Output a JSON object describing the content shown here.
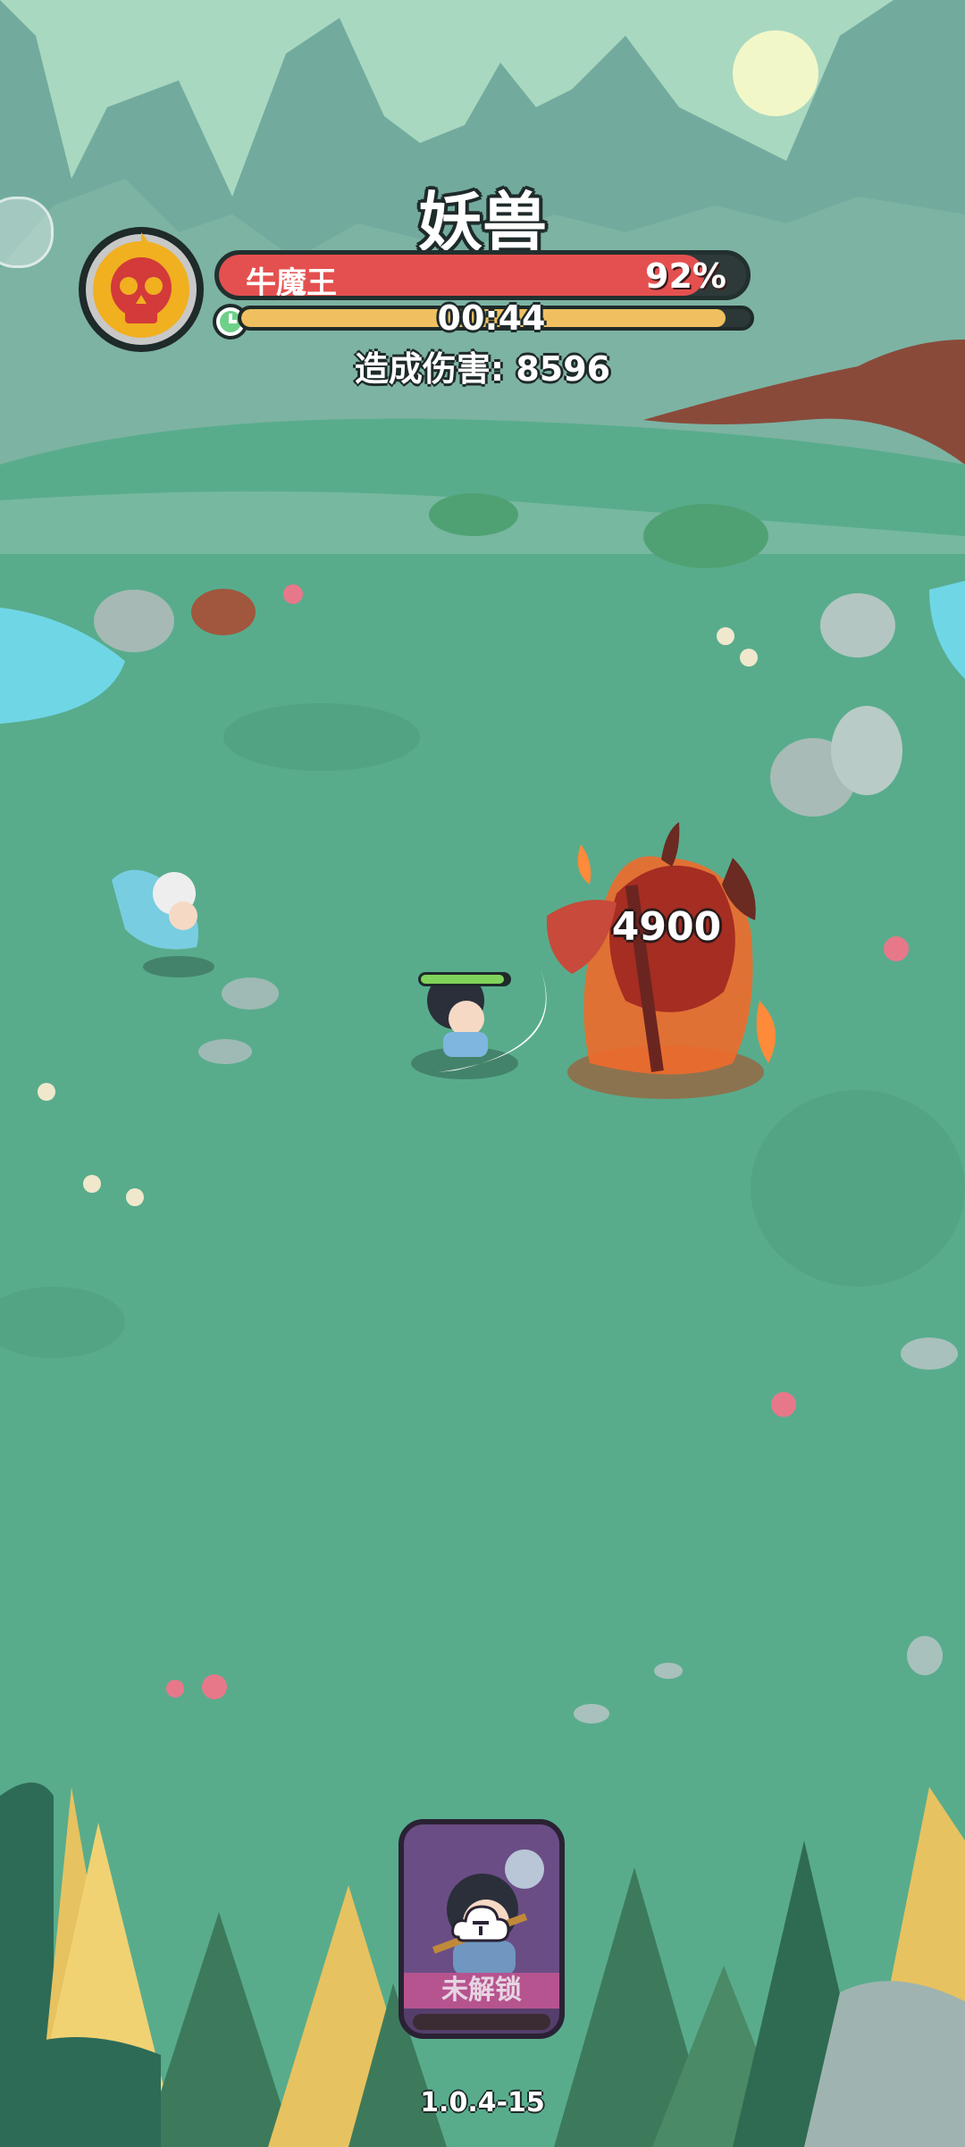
{
  "stage": {
    "title": "妖兽"
  },
  "boss": {
    "name": "牛魔王",
    "hp_percent_text": "92%",
    "hp_fraction": 0.92
  },
  "timer": {
    "text": "00:44",
    "fraction": 0.95
  },
  "damage": {
    "label": "造成伤害:",
    "value": "8596",
    "text": "造成伤害: 8596"
  },
  "floating_damage": "4900",
  "hero": {
    "hp_fraction": 0.95
  },
  "hero_card": {
    "status": "未解锁"
  },
  "version": "1.0.4-15",
  "icons": {
    "boss": "skull-icon",
    "timer": "clock-icon",
    "lock": "lock-icon"
  },
  "colors": {
    "hp": "#e4504f",
    "timer": "#f0c060",
    "card_label": "#b6548f",
    "hero_hp": "#7fd35a"
  }
}
